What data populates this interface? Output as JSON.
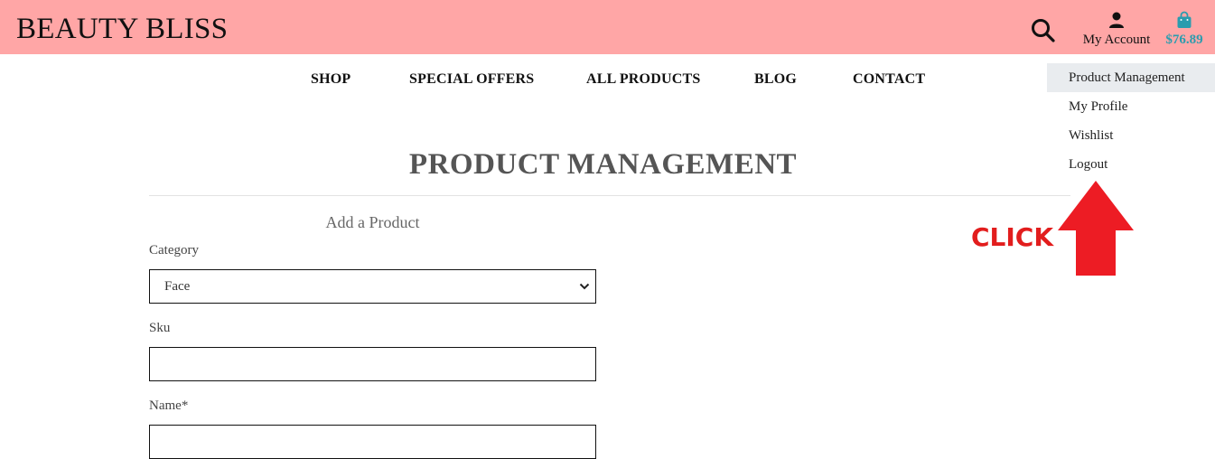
{
  "header": {
    "brand": "BEAUTY BLISS",
    "account_label": "My Account",
    "bag_total": "$76.89",
    "icons": {
      "search": "search-icon",
      "account": "user-icon",
      "bag": "shopping-bag-icon"
    },
    "colors": {
      "bar": "#ffa6a6",
      "bag_total": "#2a9cae"
    }
  },
  "nav": {
    "items": [
      "SHOP",
      "SPECIAL OFFERS",
      "ALL PRODUCTS",
      "BLOG",
      "CONTACT"
    ]
  },
  "account_menu": {
    "items": [
      {
        "label": "Product Management",
        "active": true
      },
      {
        "label": "My Profile",
        "active": false
      },
      {
        "label": "Wishlist",
        "active": false
      },
      {
        "label": "Logout",
        "active": false
      }
    ]
  },
  "page": {
    "title": "PRODUCT MANAGEMENT",
    "subtitle": "Add a Product"
  },
  "form": {
    "category_label": "Category",
    "category_value": "Face",
    "sku_label": "Sku",
    "sku_value": "",
    "name_label": "Name*",
    "name_value": ""
  },
  "annotation": {
    "text": "CLICK",
    "color": "#e21d1d",
    "icon": "up-arrow-icon"
  }
}
